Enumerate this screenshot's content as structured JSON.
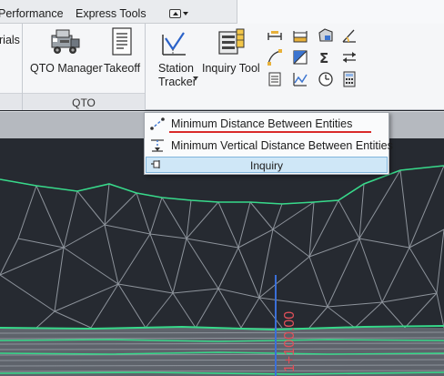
{
  "tabs": {
    "performance": "Performance",
    "express_tools": "Express Tools"
  },
  "ribbon": {
    "partial_label": "rials",
    "qto_manager": "QTO Manager",
    "takeoff": "Takeoff",
    "station_tracker_line1": "Station",
    "station_tracker_line2": "Tracker",
    "inquiry_tool": "Inquiry Tool",
    "panel_title": "QTO"
  },
  "menu": {
    "item1": "Minimum Distance Between Entities",
    "item2": "Minimum Vertical Distance Between Entities",
    "footer": "Inquiry"
  },
  "workspace": {
    "station_label": "1+100.00"
  },
  "colors": {
    "surface_line": "#37d98a",
    "tin_line": "#9aa0a8",
    "station_text": "#e0505a",
    "station_line": "#3a6fd8",
    "underline": "#d92a2a",
    "menu_footer": "#cfe7f7"
  }
}
